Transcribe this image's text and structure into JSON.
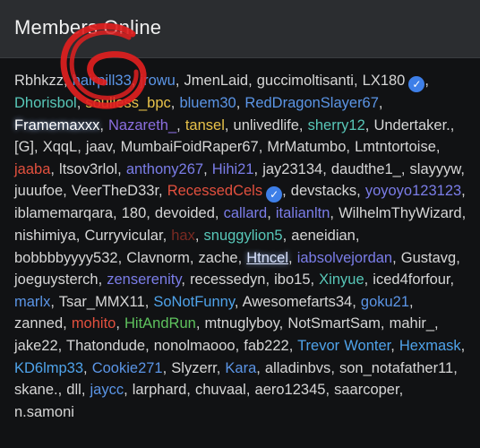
{
  "header": {
    "title": "Members Online"
  },
  "colors": {
    "accent": "#3e7fe8",
    "scribble": "#e02020"
  },
  "members": [
    {
      "name": "Rbhkzz",
      "color": "#d6d6d6"
    },
    {
      "name": "hairpill33",
      "color": "#5b95e6"
    },
    {
      "name": "jrowu",
      "color": "#5b95e6"
    },
    {
      "name": "JmenLaid",
      "color": "#d6d6d6"
    },
    {
      "name": "guccimoltisanti",
      "color": "#d6d6d6"
    },
    {
      "name": "LX180",
      "color": "#d6d6d6",
      "verified": true
    },
    {
      "name": "Dhorisbol",
      "color": "#58c7b8"
    },
    {
      "name": "soulless_bpc",
      "color": "#e8c24a"
    },
    {
      "name": "bluem30",
      "color": "#5b95e6"
    },
    {
      "name": "RedDragonSlayer67",
      "color": "#5b95e6"
    },
    {
      "name": "Framemaxxx",
      "color": "#ffffff",
      "glow": true
    },
    {
      "name": "Nazareth_",
      "color": "#8b6ee0"
    },
    {
      "name": "tansel",
      "color": "#e8c24a"
    },
    {
      "name": "unlivedlife",
      "color": "#d6d6d6"
    },
    {
      "name": "sherry12",
      "color": "#58c7b8"
    },
    {
      "name": "Undertaker.",
      "color": "#d6d6d6"
    },
    {
      "name": "[G]",
      "color": "#d6d6d6"
    },
    {
      "name": "XqqL",
      "color": "#d6d6d6"
    },
    {
      "name": "jaav",
      "color": "#d6d6d6"
    },
    {
      "name": "MumbaiFoidRaper67",
      "color": "#d6d6d6"
    },
    {
      "name": "MrMatumbo",
      "color": "#d6d6d6"
    },
    {
      "name": "Lmtntortoise",
      "color": "#d6d6d6"
    },
    {
      "name": "jaaba",
      "color": "#e2503e"
    },
    {
      "name": "ltsov3rlol",
      "color": "#d6d6d6"
    },
    {
      "name": "anthony267",
      "color": "#7b7de8"
    },
    {
      "name": "Hihi21",
      "color": "#7b7de8"
    },
    {
      "name": "jay23134",
      "color": "#d6d6d6"
    },
    {
      "name": "daudthe1_",
      "color": "#d6d6d6"
    },
    {
      "name": "slayyyw",
      "color": "#d6d6d6"
    },
    {
      "name": "juuufoe",
      "color": "#d6d6d6"
    },
    {
      "name": "VeerTheD33r",
      "color": "#d6d6d6"
    },
    {
      "name": "RecessedCels",
      "color": "#e2503e",
      "verified": true
    },
    {
      "name": "devstacks",
      "color": "#d6d6d6"
    },
    {
      "name": "yoyoyo123123",
      "color": "#7b7de8"
    },
    {
      "name": "iblamemarqara",
      "color": "#d6d6d6"
    },
    {
      "name": "180",
      "color": "#d6d6d6"
    },
    {
      "name": "devoided",
      "color": "#d6d6d6"
    },
    {
      "name": "callard",
      "color": "#7b7de8"
    },
    {
      "name": "italianltn",
      "color": "#7b7de8"
    },
    {
      "name": "WilhelmThyWizard",
      "color": "#d6d6d6"
    },
    {
      "name": "nishimiya",
      "color": "#d6d6d6"
    },
    {
      "name": "Curryvicular",
      "color": "#d6d6d6"
    },
    {
      "name": "hax",
      "color": "#7a2a22"
    },
    {
      "name": "snuggylion5",
      "color": "#58c7b8"
    },
    {
      "name": "aeneidian",
      "color": "#d6d6d6"
    },
    {
      "name": "bobbbbyyyy532",
      "color": "#d6d6d6"
    },
    {
      "name": "Clavnorm",
      "color": "#d6d6d6"
    },
    {
      "name": "zache",
      "color": "#d6d6d6"
    },
    {
      "name": "Htncel",
      "color": "#dbe4ff",
      "glow": true,
      "underline": true
    },
    {
      "name": "iabsolvejordan",
      "color": "#7b7de8"
    },
    {
      "name": "Gustavg",
      "color": "#d6d6d6"
    },
    {
      "name": "joeguysterch",
      "color": "#d6d6d6"
    },
    {
      "name": "zenserenity",
      "color": "#7b7de8"
    },
    {
      "name": "recessedyn",
      "color": "#d6d6d6"
    },
    {
      "name": "ibo15",
      "color": "#d6d6d6"
    },
    {
      "name": "Xinyue",
      "color": "#58c7b8"
    },
    {
      "name": "iced4forfour",
      "color": "#d6d6d6"
    },
    {
      "name": "marlx",
      "color": "#5b95e6"
    },
    {
      "name": "Tsar_MMX11",
      "color": "#d6d6d6"
    },
    {
      "name": "SoNotFunny",
      "color": "#4fa3ea"
    },
    {
      "name": "Awesomefarts34",
      "color": "#d6d6d6"
    },
    {
      "name": "goku21",
      "color": "#5b95e6"
    },
    {
      "name": "zanned",
      "color": "#d6d6d6"
    },
    {
      "name": "mohito",
      "color": "#e2503e"
    },
    {
      "name": "HitAndRun",
      "color": "#5ec25e"
    },
    {
      "name": "mtnuglyboy",
      "color": "#d6d6d6"
    },
    {
      "name": "NotSmartSam",
      "color": "#d6d6d6"
    },
    {
      "name": "mahir_",
      "color": "#d6d6d6"
    },
    {
      "name": "jake22",
      "color": "#d6d6d6"
    },
    {
      "name": "Thatondude",
      "color": "#d6d6d6"
    },
    {
      "name": "nonolmaooo",
      "color": "#d6d6d6"
    },
    {
      "name": "fab222",
      "color": "#d6d6d6"
    },
    {
      "name": "Trevor Wonter",
      "color": "#4fa3ea"
    },
    {
      "name": "Hexmask",
      "color": "#4fa3ea"
    },
    {
      "name": "KD6lmp33",
      "color": "#4fa3ea"
    },
    {
      "name": "Cookie271",
      "color": "#5b95e6"
    },
    {
      "name": "Slyzerr",
      "color": "#d6d6d6"
    },
    {
      "name": "Kara",
      "color": "#5b95e6"
    },
    {
      "name": "alladinbvs",
      "color": "#d6d6d6"
    },
    {
      "name": "son_notafather11",
      "color": "#d6d6d6"
    },
    {
      "name": "skane.",
      "color": "#d6d6d6"
    },
    {
      "name": "dll",
      "color": "#d6d6d6"
    },
    {
      "name": "jaycc",
      "color": "#5b95e6"
    },
    {
      "name": "larphard",
      "color": "#d6d6d6"
    },
    {
      "name": "chuvaal",
      "color": "#d6d6d6"
    },
    {
      "name": "aero12345",
      "color": "#d6d6d6"
    },
    {
      "name": "saarcoper",
      "color": "#d6d6d6"
    },
    {
      "name": "n.samoni",
      "color": "#d6d6d6"
    }
  ]
}
